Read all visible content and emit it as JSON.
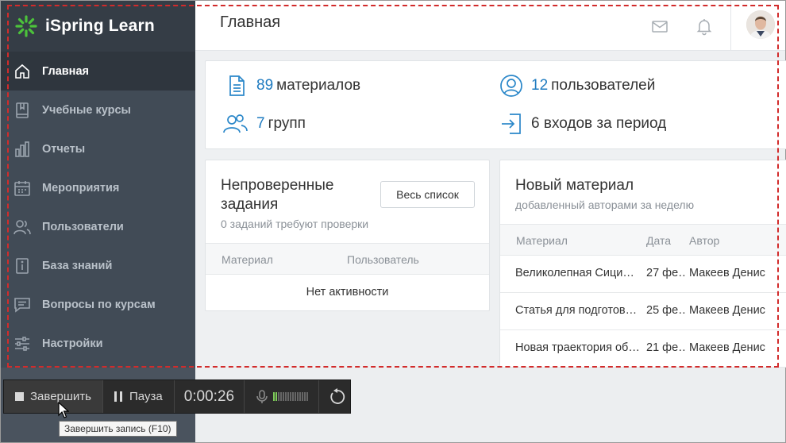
{
  "app": {
    "name": "iSpring Learn",
    "brand_color": "#4cc23b",
    "accent": "#1f7bc0"
  },
  "header": {
    "title": "Главная",
    "icons": [
      "mail-icon",
      "bell-icon"
    ]
  },
  "sidebar": {
    "items": [
      {
        "label": "Главная",
        "icon": "home-icon",
        "active": true
      },
      {
        "label": "Учебные курсы",
        "icon": "book-icon"
      },
      {
        "label": "Отчеты",
        "icon": "bar-chart-icon"
      },
      {
        "label": "Мероприятия",
        "icon": "calendar-icon"
      },
      {
        "label": "Пользователи",
        "icon": "users-icon"
      },
      {
        "label": "База знаний",
        "icon": "info-book-icon"
      },
      {
        "label": "Вопросы по курсам",
        "icon": "chat-icon"
      },
      {
        "label": "Настройки",
        "icon": "sliders-icon"
      }
    ]
  },
  "stats": {
    "materials": {
      "num": "89",
      "label": "материалов"
    },
    "users": {
      "num": "12",
      "label": "пользователей"
    },
    "groups": {
      "num": "7",
      "label": "групп"
    },
    "logins": {
      "label": "6 входов за период"
    }
  },
  "tasks": {
    "title_line1": "Непроверенные",
    "title_line2": "задания",
    "subtitle": "0 заданий требуют проверки",
    "button": "Весь список",
    "columns": [
      "Материал",
      "Пользователь"
    ],
    "empty": "Нет активности"
  },
  "new_material": {
    "title": "Новый материал",
    "subtitle": "добавленный авторами за неделю",
    "columns": [
      "Материал",
      "Дата",
      "Автор"
    ],
    "rows": [
      {
        "material": "Великолепная Сици…",
        "date": "27 фе…",
        "author": "Макеев Денис"
      },
      {
        "material": "Статья для подготов…",
        "date": "25 фе…",
        "author": "Макеев Денис"
      },
      {
        "material": "Новая траектория об…",
        "date": "21 фе…",
        "author": "Макеев Денис"
      }
    ]
  },
  "recorder": {
    "finish": "Завершить",
    "pause": "Пауза",
    "time": "0:00:26",
    "tooltip": "Завершить запись (F10)"
  }
}
